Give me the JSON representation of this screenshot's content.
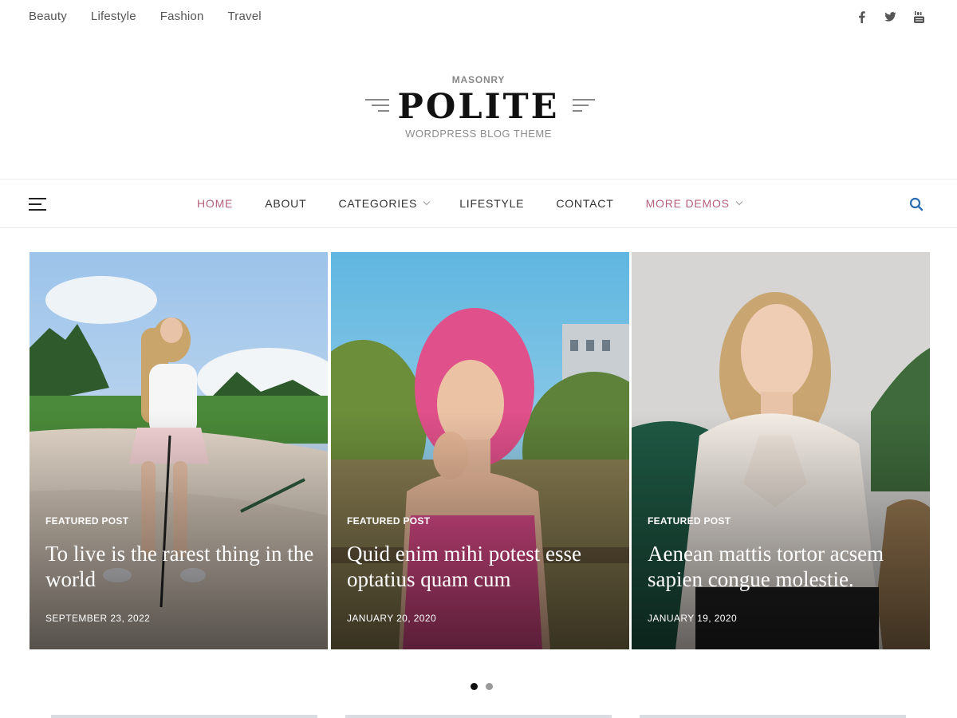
{
  "topbar": {
    "categories": [
      "Beauty",
      "Lifestyle",
      "Fashion",
      "Travel"
    ],
    "social": [
      "facebook-icon",
      "twitter-icon",
      "youtube-icon"
    ]
  },
  "logo": {
    "tagline": "MASONRY",
    "title": "POLITE",
    "subtitle": "WORDPRESS BLOG THEME"
  },
  "nav": {
    "items": [
      {
        "label": "HOME",
        "state": "active"
      },
      {
        "label": "ABOUT"
      },
      {
        "label": "CATEGORIES",
        "dropdown": true
      },
      {
        "label": "LIFESTYLE"
      },
      {
        "label": "CONTACT"
      },
      {
        "label": "MORE DEMOS",
        "dropdown": true,
        "state": "accent"
      }
    ],
    "search_icon": "search-icon",
    "menu_icon": "hamburger-menu-icon"
  },
  "slides": [
    {
      "label": "FEATURED POST",
      "title": "To live is the rarest thing in the world",
      "date": "SEPTEMBER 23, 2022"
    },
    {
      "label": "FEATURED POST",
      "title": "Quid enim mihi potest esse optatius quam cum",
      "date": "JANUARY 20, 2020"
    },
    {
      "label": "FEATURED POST",
      "title": "Aenean mattis tortor acsem sapien congue molestie.",
      "date": "JANUARY 19, 2020"
    }
  ],
  "pagination": {
    "pages": 2,
    "active": 1
  },
  "colors": {
    "accent": "#b5607a",
    "search": "#2b6cb0",
    "text": "#333333"
  }
}
